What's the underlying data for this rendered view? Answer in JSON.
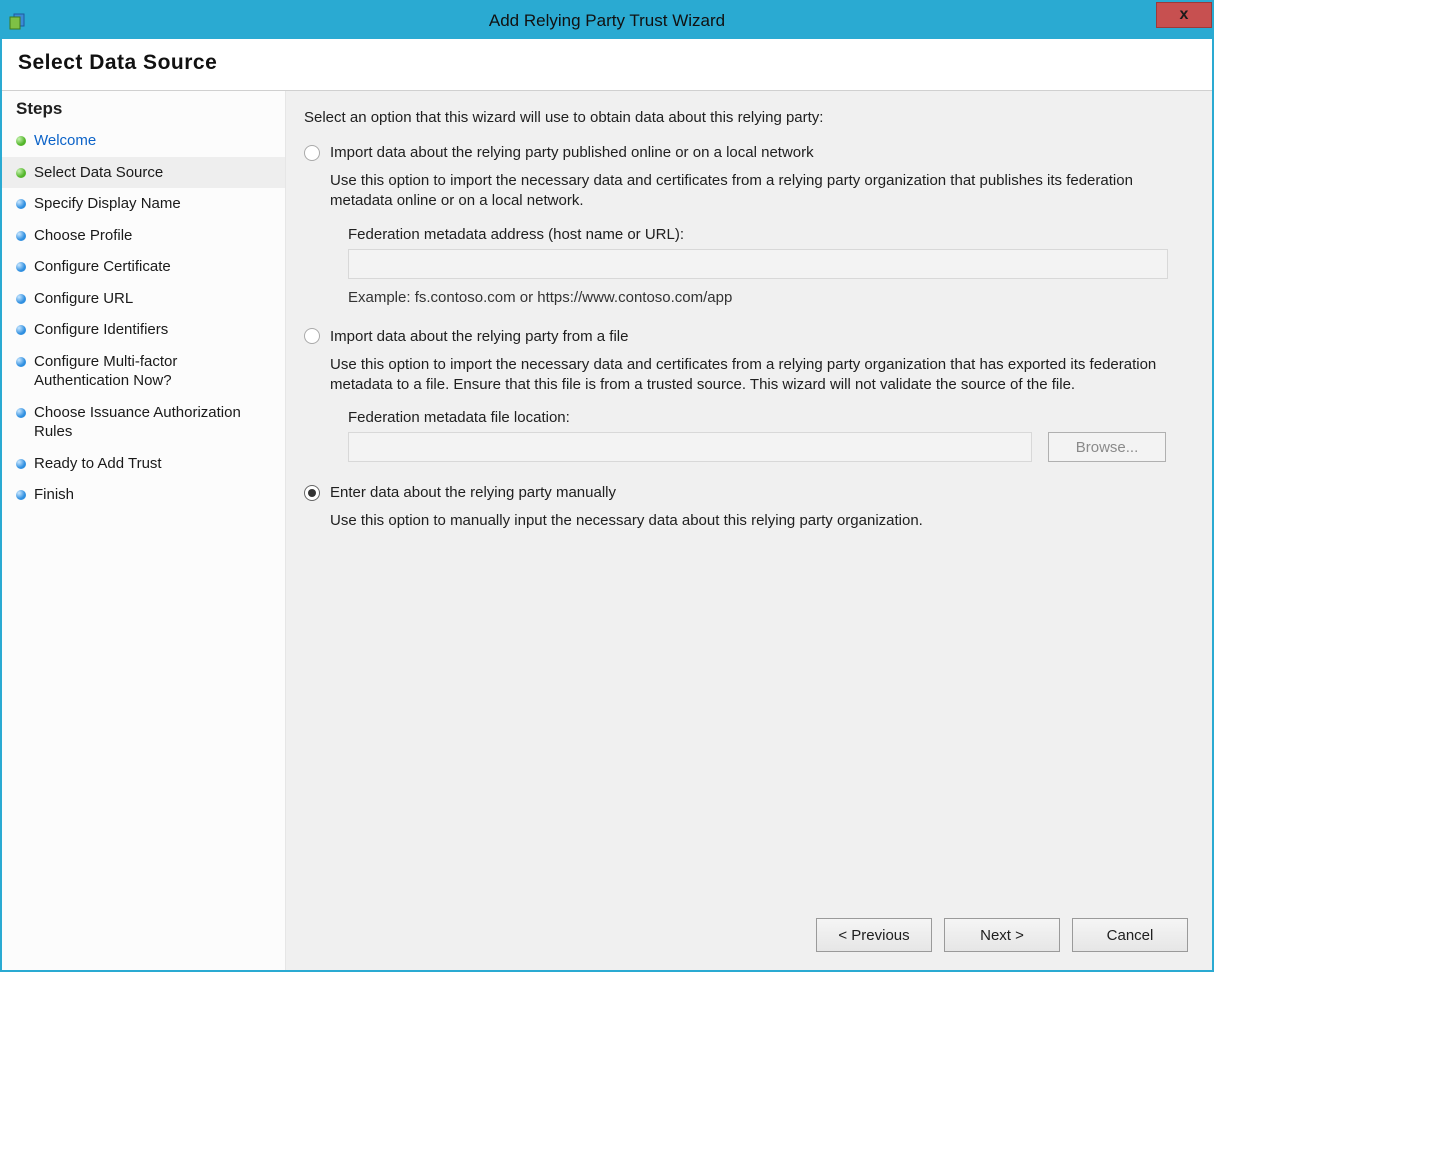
{
  "window": {
    "title": "Add Relying Party Trust Wizard",
    "close_tooltip": "x"
  },
  "banner": {
    "title": "Select Data Source"
  },
  "sidebar": {
    "title": "Steps",
    "items": [
      {
        "label": "Welcome",
        "bullet": "green",
        "link": true,
        "current": false
      },
      {
        "label": "Select Data Source",
        "bullet": "green",
        "link": false,
        "current": true
      },
      {
        "label": "Specify Display Name",
        "bullet": "blue",
        "link": false,
        "current": false
      },
      {
        "label": "Choose Profile",
        "bullet": "blue",
        "link": false,
        "current": false
      },
      {
        "label": "Configure Certificate",
        "bullet": "blue",
        "link": false,
        "current": false
      },
      {
        "label": "Configure URL",
        "bullet": "blue",
        "link": false,
        "current": false
      },
      {
        "label": "Configure Identifiers",
        "bullet": "blue",
        "link": false,
        "current": false
      },
      {
        "label": "Configure Multi-factor Authentication Now?",
        "bullet": "blue",
        "link": false,
        "current": false
      },
      {
        "label": "Choose Issuance Authorization Rules",
        "bullet": "blue",
        "link": false,
        "current": false
      },
      {
        "label": "Ready to Add Trust",
        "bullet": "blue",
        "link": false,
        "current": false
      },
      {
        "label": "Finish",
        "bullet": "blue",
        "link": false,
        "current": false
      }
    ]
  },
  "main": {
    "instruction": "Select an option that this wizard will use to obtain data about this relying party:",
    "options": {
      "online": {
        "label": "Import data about the relying party published online or on a local network",
        "desc": "Use this option to import the necessary data and certificates from a relying party organization that publishes its federation metadata online or on a local network.",
        "field_label": "Federation metadata address (host name or URL):",
        "field_value": "",
        "example": "Example: fs.contoso.com or https://www.contoso.com/app",
        "selected": false,
        "enabled": false
      },
      "file": {
        "label": "Import data about the relying party from a file",
        "desc": "Use this option to import the necessary data and certificates from a relying party organization that has exported its federation metadata to a file. Ensure that this file is from a trusted source.  This wizard will not validate the source of the file.",
        "field_label": "Federation metadata file location:",
        "field_value": "",
        "browse_label": "Browse...",
        "selected": false,
        "enabled": false
      },
      "manual": {
        "label": "Enter data about the relying party manually",
        "desc": "Use this option to manually input the necessary data about this relying party organization.",
        "selected": true
      }
    },
    "buttons": {
      "previous": "< Previous",
      "next": "Next >",
      "cancel": "Cancel"
    }
  }
}
